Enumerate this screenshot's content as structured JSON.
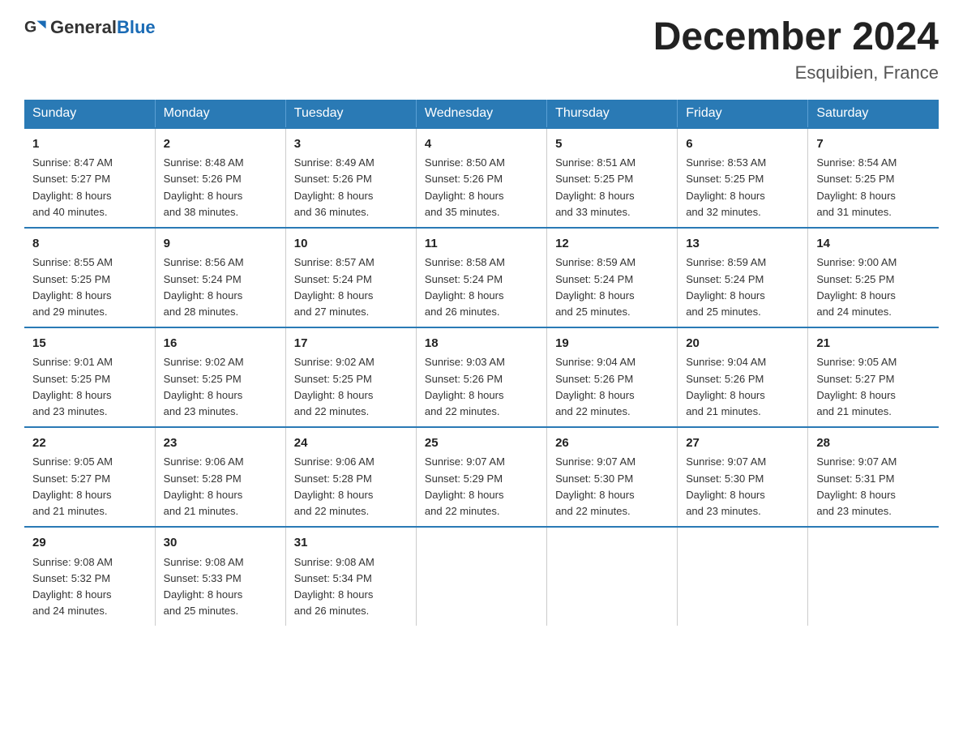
{
  "header": {
    "logo_general": "General",
    "logo_blue": "Blue",
    "title": "December 2024",
    "subtitle": "Esquibien, France"
  },
  "days_of_week": [
    "Sunday",
    "Monday",
    "Tuesday",
    "Wednesday",
    "Thursday",
    "Friday",
    "Saturday"
  ],
  "weeks": [
    [
      {
        "day": "1",
        "sunrise": "8:47 AM",
        "sunset": "5:27 PM",
        "daylight": "8 hours and 40 minutes."
      },
      {
        "day": "2",
        "sunrise": "8:48 AM",
        "sunset": "5:26 PM",
        "daylight": "8 hours and 38 minutes."
      },
      {
        "day": "3",
        "sunrise": "8:49 AM",
        "sunset": "5:26 PM",
        "daylight": "8 hours and 36 minutes."
      },
      {
        "day": "4",
        "sunrise": "8:50 AM",
        "sunset": "5:26 PM",
        "daylight": "8 hours and 35 minutes."
      },
      {
        "day": "5",
        "sunrise": "8:51 AM",
        "sunset": "5:25 PM",
        "daylight": "8 hours and 33 minutes."
      },
      {
        "day": "6",
        "sunrise": "8:53 AM",
        "sunset": "5:25 PM",
        "daylight": "8 hours and 32 minutes."
      },
      {
        "day": "7",
        "sunrise": "8:54 AM",
        "sunset": "5:25 PM",
        "daylight": "8 hours and 31 minutes."
      }
    ],
    [
      {
        "day": "8",
        "sunrise": "8:55 AM",
        "sunset": "5:25 PM",
        "daylight": "8 hours and 29 minutes."
      },
      {
        "day": "9",
        "sunrise": "8:56 AM",
        "sunset": "5:24 PM",
        "daylight": "8 hours and 28 minutes."
      },
      {
        "day": "10",
        "sunrise": "8:57 AM",
        "sunset": "5:24 PM",
        "daylight": "8 hours and 27 minutes."
      },
      {
        "day": "11",
        "sunrise": "8:58 AM",
        "sunset": "5:24 PM",
        "daylight": "8 hours and 26 minutes."
      },
      {
        "day": "12",
        "sunrise": "8:59 AM",
        "sunset": "5:24 PM",
        "daylight": "8 hours and 25 minutes."
      },
      {
        "day": "13",
        "sunrise": "8:59 AM",
        "sunset": "5:24 PM",
        "daylight": "8 hours and 25 minutes."
      },
      {
        "day": "14",
        "sunrise": "9:00 AM",
        "sunset": "5:25 PM",
        "daylight": "8 hours and 24 minutes."
      }
    ],
    [
      {
        "day": "15",
        "sunrise": "9:01 AM",
        "sunset": "5:25 PM",
        "daylight": "8 hours and 23 minutes."
      },
      {
        "day": "16",
        "sunrise": "9:02 AM",
        "sunset": "5:25 PM",
        "daylight": "8 hours and 23 minutes."
      },
      {
        "day": "17",
        "sunrise": "9:02 AM",
        "sunset": "5:25 PM",
        "daylight": "8 hours and 22 minutes."
      },
      {
        "day": "18",
        "sunrise": "9:03 AM",
        "sunset": "5:26 PM",
        "daylight": "8 hours and 22 minutes."
      },
      {
        "day": "19",
        "sunrise": "9:04 AM",
        "sunset": "5:26 PM",
        "daylight": "8 hours and 22 minutes."
      },
      {
        "day": "20",
        "sunrise": "9:04 AM",
        "sunset": "5:26 PM",
        "daylight": "8 hours and 21 minutes."
      },
      {
        "day": "21",
        "sunrise": "9:05 AM",
        "sunset": "5:27 PM",
        "daylight": "8 hours and 21 minutes."
      }
    ],
    [
      {
        "day": "22",
        "sunrise": "9:05 AM",
        "sunset": "5:27 PM",
        "daylight": "8 hours and 21 minutes."
      },
      {
        "day": "23",
        "sunrise": "9:06 AM",
        "sunset": "5:28 PM",
        "daylight": "8 hours and 21 minutes."
      },
      {
        "day": "24",
        "sunrise": "9:06 AM",
        "sunset": "5:28 PM",
        "daylight": "8 hours and 22 minutes."
      },
      {
        "day": "25",
        "sunrise": "9:07 AM",
        "sunset": "5:29 PM",
        "daylight": "8 hours and 22 minutes."
      },
      {
        "day": "26",
        "sunrise": "9:07 AM",
        "sunset": "5:30 PM",
        "daylight": "8 hours and 22 minutes."
      },
      {
        "day": "27",
        "sunrise": "9:07 AM",
        "sunset": "5:30 PM",
        "daylight": "8 hours and 23 minutes."
      },
      {
        "day": "28",
        "sunrise": "9:07 AM",
        "sunset": "5:31 PM",
        "daylight": "8 hours and 23 minutes."
      }
    ],
    [
      {
        "day": "29",
        "sunrise": "9:08 AM",
        "sunset": "5:32 PM",
        "daylight": "8 hours and 24 minutes."
      },
      {
        "day": "30",
        "sunrise": "9:08 AM",
        "sunset": "5:33 PM",
        "daylight": "8 hours and 25 minutes."
      },
      {
        "day": "31",
        "sunrise": "9:08 AM",
        "sunset": "5:34 PM",
        "daylight": "8 hours and 26 minutes."
      },
      null,
      null,
      null,
      null
    ]
  ],
  "labels": {
    "sunrise": "Sunrise:",
    "sunset": "Sunset:",
    "daylight": "Daylight:"
  }
}
